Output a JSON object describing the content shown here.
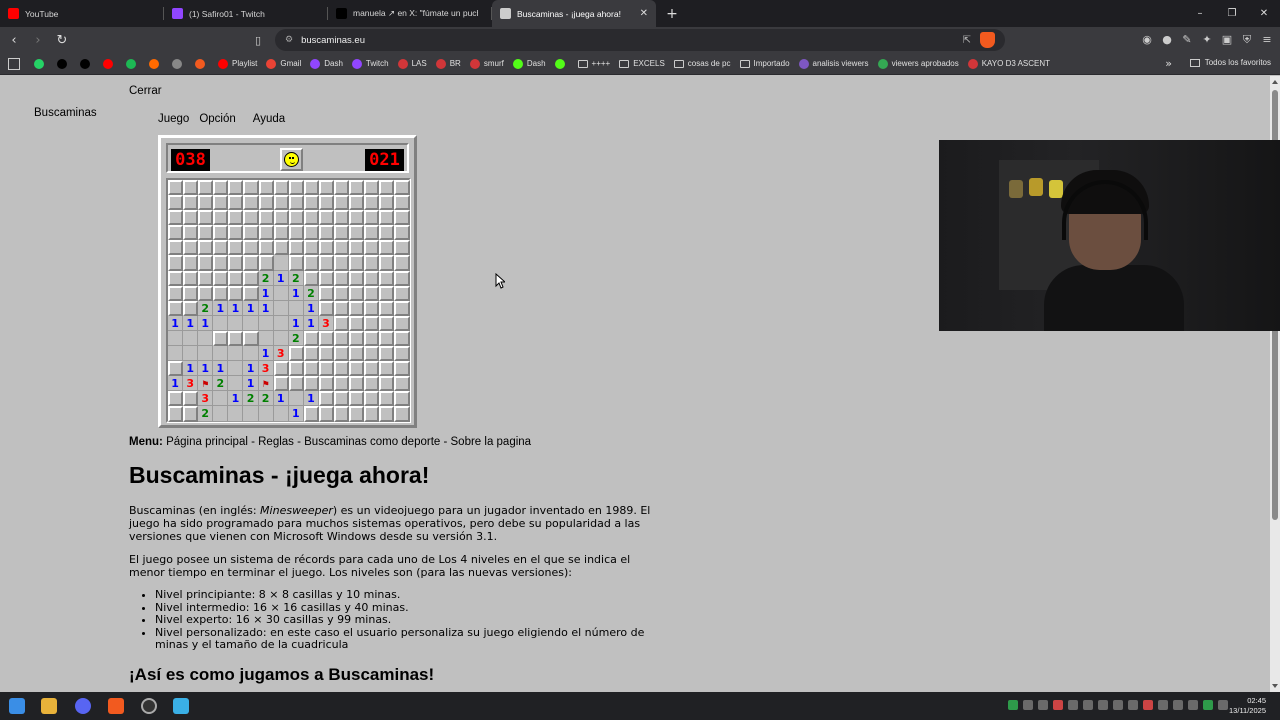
{
  "browser": {
    "tabs": [
      {
        "label": "YouTube",
        "favicon_color": "#ff0000",
        "active": false
      },
      {
        "label": "(1) Safiro01 - Twitch",
        "favicon_color": "#9146ff",
        "active": false
      },
      {
        "label": "manuela ↗ en X: \"fúmate un pucho e",
        "favicon_color": "#000000",
        "active": false
      },
      {
        "label": "Buscaminas - ¡juega ahora!",
        "favicon_color": "#cccccc",
        "active": true
      }
    ],
    "new_tab": "+",
    "window_controls": [
      "–",
      "❐",
      "✕"
    ],
    "url": "buscaminas.eu",
    "nav": {
      "back": "‹",
      "forward": "›",
      "reload": "↻"
    },
    "bookmarks": [
      {
        "label": "",
        "icon_color": "#25d366"
      },
      {
        "label": "",
        "icon_color": "#000000"
      },
      {
        "label": "",
        "icon_color": "#010101"
      },
      {
        "label": "",
        "icon_color": "#ff0000"
      },
      {
        "label": "",
        "icon_color": "#1db954"
      },
      {
        "label": "",
        "icon_color": "#ff6a00"
      },
      {
        "label": "",
        "icon_color": "#888888"
      },
      {
        "label": "",
        "icon_color": "#f25a1f"
      },
      {
        "label": "Playlist",
        "icon_color": "#ff0000"
      },
      {
        "label": "Gmail",
        "icon_color": "#ea4335"
      },
      {
        "label": "Dash",
        "icon_color": "#9146ff"
      },
      {
        "label": "Twitch",
        "icon_color": "#9146ff"
      },
      {
        "label": "LAS",
        "icon_color": "#d13639"
      },
      {
        "label": "BR",
        "icon_color": "#d13639"
      },
      {
        "label": "smurf",
        "icon_color": "#d13639"
      },
      {
        "label": "Dash",
        "icon_color": "#53fc18"
      },
      {
        "label": "",
        "icon_color": "#53fc18"
      },
      {
        "label": "++++",
        "icon_color": "folder"
      },
      {
        "label": "EXCELS",
        "icon_color": "folder"
      },
      {
        "label": "cosas de pc",
        "icon_color": "folder"
      },
      {
        "label": "Importado",
        "icon_color": "folder"
      },
      {
        "label": "analisis viewers",
        "icon_color": "#7e57c2"
      },
      {
        "label": "viewers aprobados",
        "icon_color": "#34a853"
      },
      {
        "label": "KAYO D3 ASCENT",
        "icon_color": "#d13639"
      }
    ],
    "more_bookmarks": "»",
    "all_favorites": "Todos los favoritos"
  },
  "page": {
    "close_link": "Cerrar",
    "side_title": "Buscaminas",
    "game_menu": [
      "Juego",
      "Opción",
      "Ayuda"
    ],
    "mines_counter": "038",
    "timer": "021",
    "menu_label": "Menu:",
    "menu_links": "Página principal - Reglas - Buscaminas como deporte - Sobre la pagina",
    "heading": "Buscaminas - ¡juega ahora!",
    "para1_before": "Buscaminas (en inglés: ",
    "para1_em": "Minesweeper",
    "para1_after": ") es un videojuego para un jugador inventado en 1989. El juego ha sido programado para muchos sistemas operativos, pero debe su popularidad a las versiones que vienen con Microsoft Windows desde su versión 3.1.",
    "para2": "El juego posee un sistema de récords para cada uno de Los 4 niveles en el que se indica el menor tiempo en terminar el juego. Los niveles son (para las nuevas versiones):",
    "levels": [
      "Nivel principiante: 8 × 8 casillas y 10 minas.",
      "Nivel intermedio: 16 × 16 casillas y 40 minas.",
      "Nivel experto: 16 × 30 casillas y 99 minas.",
      "Nivel personalizado: en este caso el usuario personaliza su juego eligiendo el número de minas y el tamaño de la cuadricula"
    ],
    "subheading": "¡Así es como jugamos a Buscaminas!"
  },
  "board": {
    "legend": "H = hidden, . = opened empty, F = flag, digits = adjacent mines",
    "rows": [
      "HHHHHHHHHHHHHHHH",
      "HHHHHHHHHHHHHHHH",
      "HHHHHHHHHHHHHHHH",
      "HHHHHHHHHHHHHHHH",
      "HHHHHHHHHHHHHHHH",
      "HHHHHHH.HHHHHHHH",
      "HHHHHH212HHHHHHH",
      "HHHHHH1.12HHHHHH",
      "HH21111..1HHHHHH",
      "111.....113HHHHH",
      "...HHH..2HHHHHHH",
      "......13HHHHHHHH",
      "H111.13HHHHHHHHH",
      "13F2.1FHHHHHHHHH",
      "HH3.1221 1HHHHHH",
      "HH2.....1HHHHHHH"
    ]
  },
  "taskbar": {
    "time": "02:45",
    "date": "13/11/2025"
  },
  "colors": {
    "page_bg": "#c0c0c0",
    "browser_dark": "#1e1e22",
    "browser_mid": "#3a3a3e",
    "digit_1": "#0000ff",
    "digit_2": "#008000",
    "digit_3": "#ff0000",
    "lcd_red": "#ff0000"
  }
}
